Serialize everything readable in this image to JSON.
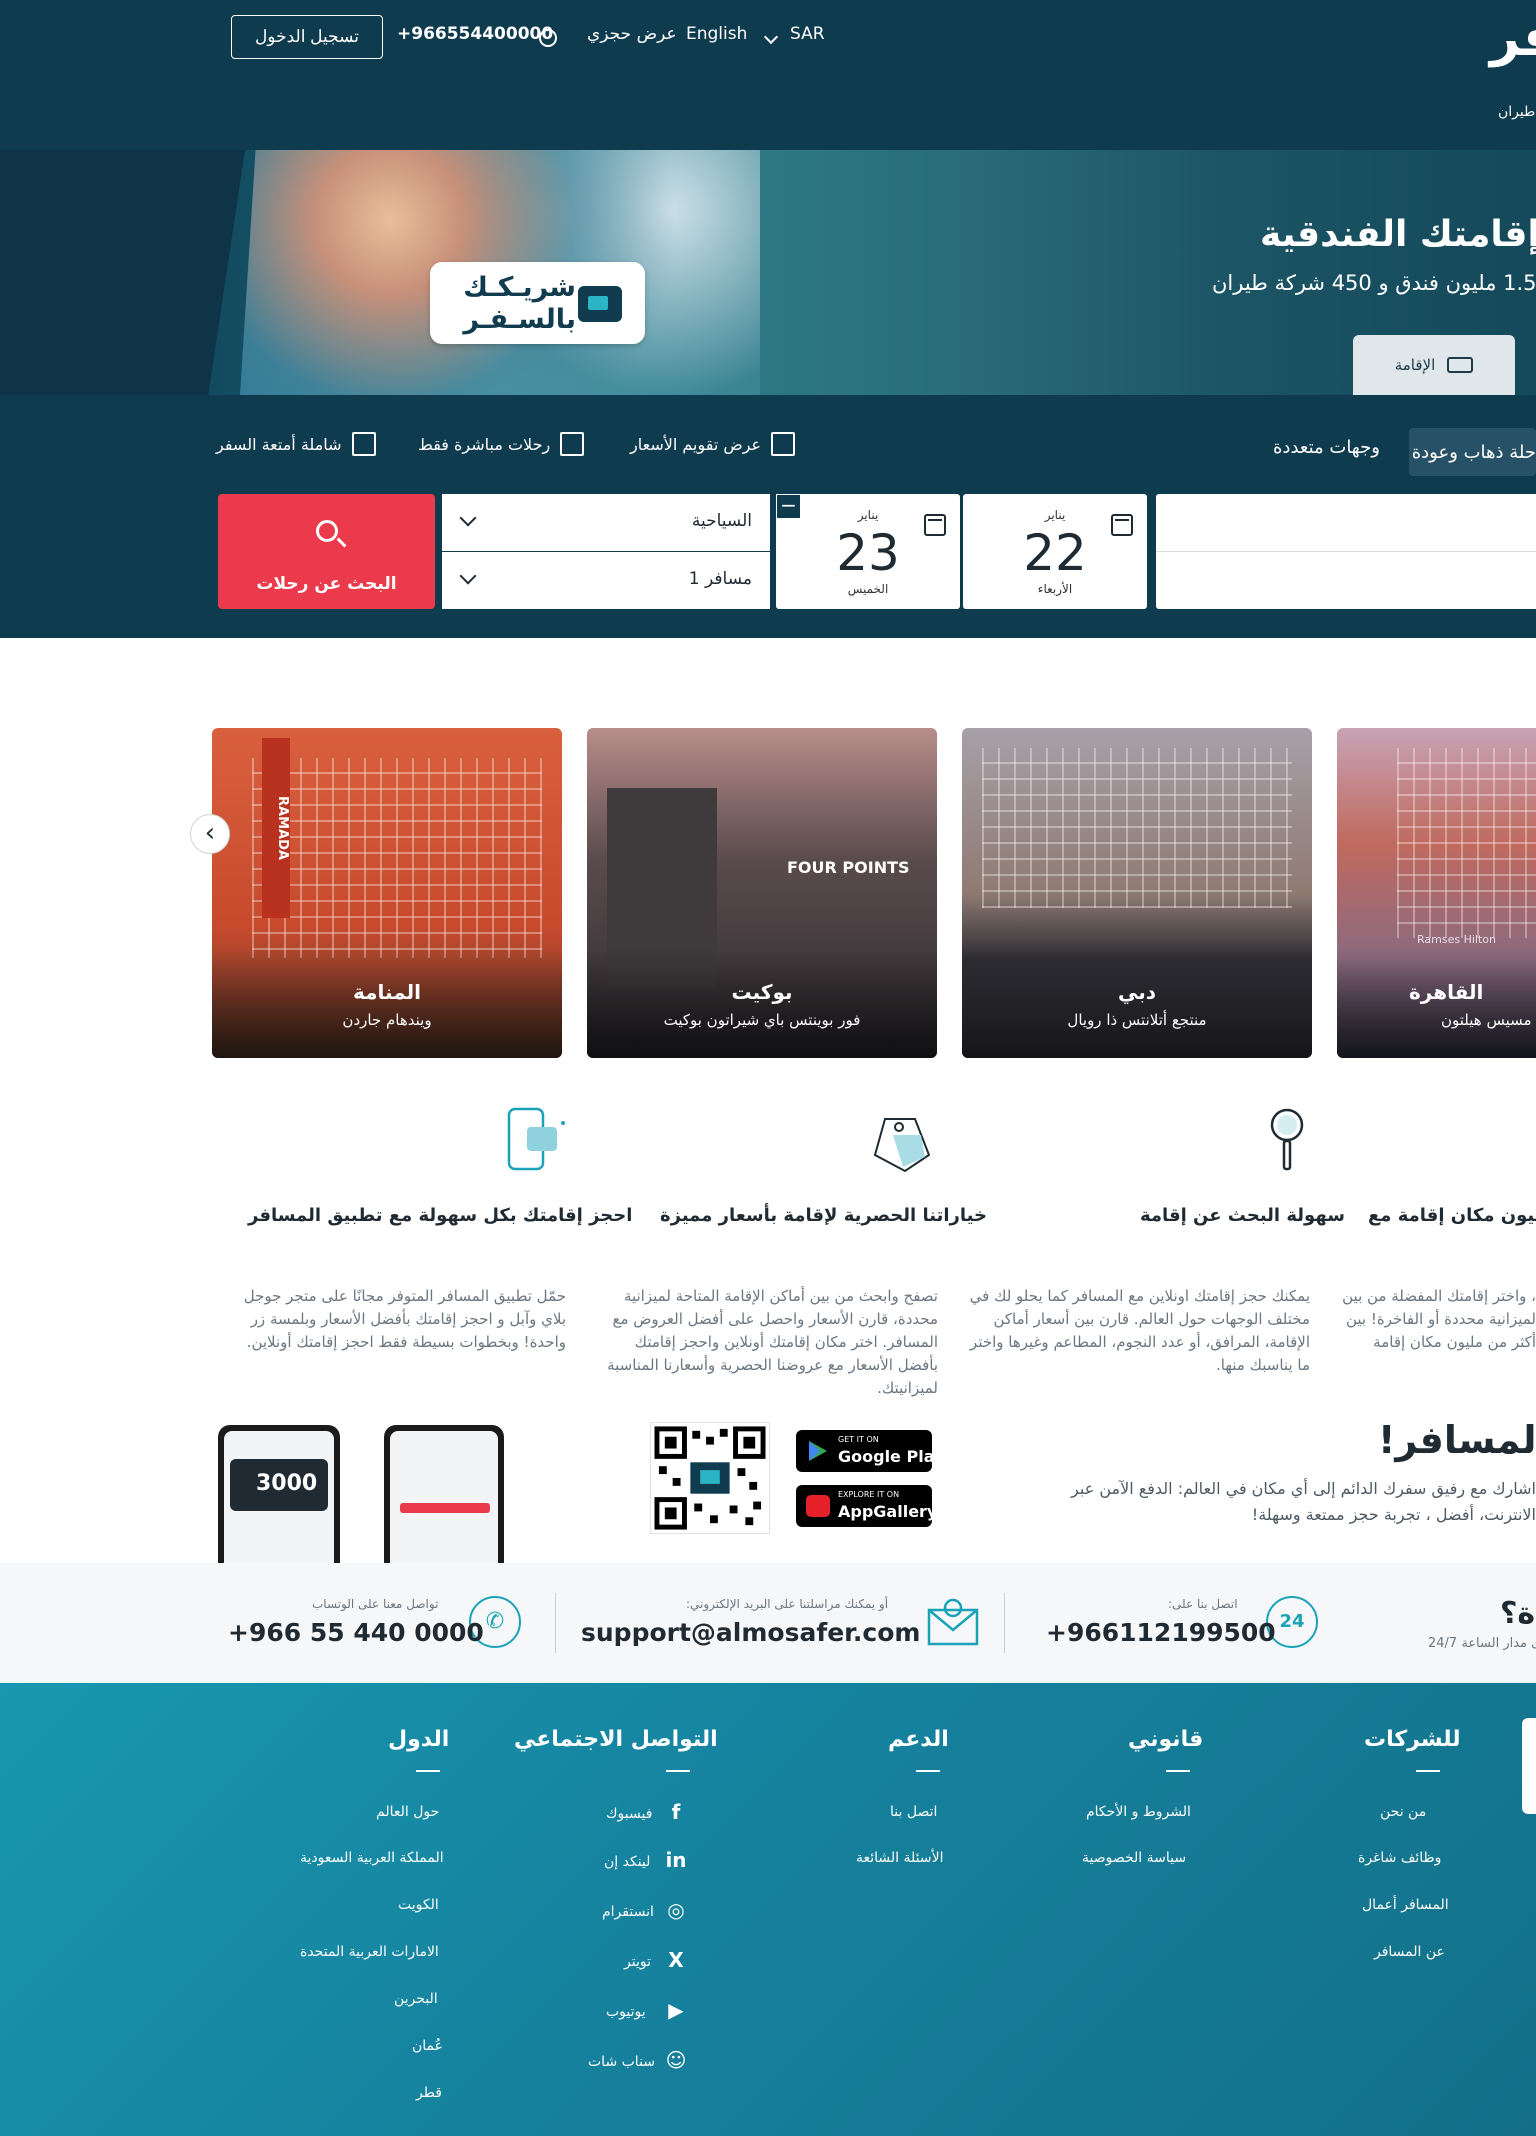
{
  "header": {
    "logo": "فر",
    "login_button": "تسجيل الدخول",
    "phone": "+966554400000",
    "my_booking": "عرض حجزي",
    "language": "English",
    "currency": "SAR",
    "nav_flights": "طيران"
  },
  "hero": {
    "badge_line1": "شريـكـك",
    "badge_line2": "بالسـفـر",
    "title": "ز إقامتك الفندقية",
    "subtitle": "من 1.5 مليون فندق و 450 شركة طيران",
    "stay_tab": "الإقامة"
  },
  "search": {
    "trip_type": "حلة ذهاب وعودة",
    "multi_destinations": "وجهات متعددة",
    "option_calendar": "عرض تقويم الأسعار",
    "option_direct": "رحلات مباشرة فقط",
    "option_baggage": "شاملة أمتعة السفر",
    "cabin_class": "السياحية",
    "passengers": "1 مسافر",
    "departure": {
      "month": "يناير",
      "day": "22",
      "weekday": "الأربعاء"
    },
    "return": {
      "month": "يناير",
      "day": "23",
      "weekday": "الخميس"
    },
    "minus": "−",
    "search_button": "البحث عن رحلات"
  },
  "destinations": [
    {
      "city": "المنامة",
      "hotel": "ويندهام جاردن",
      "sign": "RAMADA"
    },
    {
      "city": "بوكيت",
      "hotel": "فور بوينتس باي شيراتون بوكيت",
      "sign": "FOUR POINTS"
    },
    {
      "city": "دبي",
      "hotel": "منتجع أتلانتس ذا رويال"
    },
    {
      "city": "القاهرة",
      "hotel": "مسيس هيلتون",
      "sign": "Ramses Hilton"
    }
  ],
  "features": [
    {
      "title": "ن مليون مكان إقامة مع",
      "desc": "، واختر إقامتك المفضلة من بين لميزانية محددة أو الفاخرة! بين أكثر من مليون مكان إقامة"
    },
    {
      "title": "سهولة البحث عن إقامة",
      "desc": "يمكنك حجز إقامتك اونلاين مع المسافر كما يحلو لك في مختلف الوجهات حول العالم. قارن بين أسعار أماكن الإقامة، المرافق، أو عدد النجوم، المطاعم وغيرها واختر ما يناسبك منها."
    },
    {
      "title": "خياراتنا الحصرية لإقامة بأسعار مميزة",
      "desc": "تصفح وابحث من بين أماكن الإقامة المتاحة لميزانية محددة، قارن الأسعار واحصل على أفضل العروض مع المسافر. اختر مكان إقامتك أونلاين واحجز إقامتك بأفضل الأسعار مع عروضنا الحصرية وأسعارنا المناسبة لميزانيتك."
    },
    {
      "title": "احجز إقامتك بكل سهولة مع تطبيق المسافر",
      "desc": "حمّل تطبيق المسافر المتوفر مجانًا على متجر جوجل بلاي وآبل و احجز إقامتك بأفضل الأسعار وبلمسة زر واحدة! وبخطوات بسيطة فقط احجز إقامتك أونلاين."
    }
  ],
  "app": {
    "title": "ق المسافر!",
    "desc": "اشارك مع رفيق سفرك الدائم إلى أي مكان في العالم: الدفع الآمن عبر الانترنت، أفضل ، تجربة حجز ممتعة وسهلة!",
    "google_small": "GET IT ON",
    "google_big": "Google Play",
    "huawei_small": "EXPLORE IT ON",
    "huawei_big": "AppGallery",
    "phone_amount": "3000"
  },
  "contact": {
    "help_title": "ة؟",
    "help_sub": "ى مدار الساعة 24/7",
    "call_label": "اتصل بنا على:",
    "call_value": "+966112199500",
    "email_label": "أو يمكنك مراسلتنا على البريد الإلكتروني:",
    "email_value": "support@almosafer.com",
    "whatsapp_label": "تواصل معنا على الوتساب",
    "whatsapp_value": "+966 55 440 0000",
    "badge_24": "24"
  },
  "footer": {
    "company": {
      "title": "للشركات",
      "links": [
        "من نحن",
        "وظائف شاغرة",
        "المسافر أعمال",
        "عن المسافر"
      ]
    },
    "legal": {
      "title": "قانوني",
      "links": [
        "الشروط و الأحكام",
        "سياسة الخصوصية"
      ]
    },
    "support": {
      "title": "الدعم",
      "links": [
        "اتصل بنا",
        "الأسئلة الشائعة"
      ]
    },
    "social": {
      "title": "التواصل الاجتماعي",
      "links": [
        "فيسبوك",
        "لينكد إن",
        "انستقرام",
        "تويتر",
        "يوتيوب",
        "سناب شات"
      ],
      "icons": [
        "f",
        "in",
        "◎",
        "X",
        "▶",
        "☺"
      ]
    },
    "countries": {
      "title": "الدول",
      "links": [
        "حول العالم",
        "المملكة العربية السعودية",
        "الكويت",
        "الامارات العربية المتحدة",
        "البحرين",
        "عُمان",
        "قطر"
      ]
    }
  },
  "colors": {
    "header": "#0f3b4f",
    "accent_red": "#ea3a4c",
    "footer": "#1684a0",
    "teal": "#1aa3b8"
  }
}
